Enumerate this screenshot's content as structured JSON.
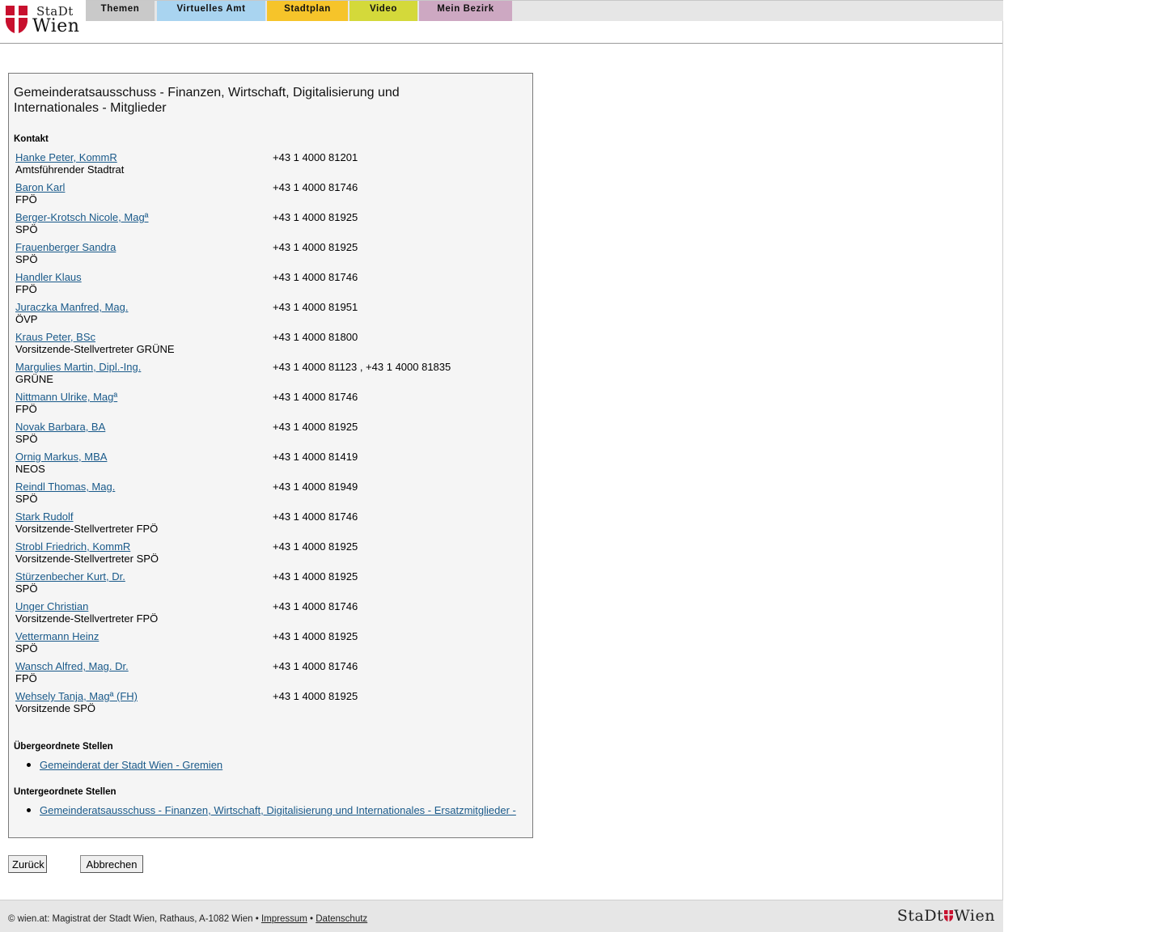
{
  "header": {
    "logo": {
      "line1": "StaDt",
      "line2": "Wien"
    },
    "nav": [
      "Themen",
      "Virtuelles Amt",
      "Stadtplan",
      "Video",
      "Mein Bezirk"
    ]
  },
  "panel": {
    "title": "Gemeinderatsausschuss - Finanzen, Wirtschaft, Digitalisierung und Internationales - Mitglieder",
    "contact_label": "Kontakt",
    "members": [
      {
        "name": "Hanke Peter, KommR",
        "role": "Amtsführender Stadtrat",
        "phone": "+43 1 4000 81201"
      },
      {
        "name": "Baron Karl",
        "role": "FPÖ",
        "phone": "+43 1 4000 81746"
      },
      {
        "name": "Berger-Krotsch Nicole, Magª",
        "role": "SPÖ",
        "phone": "+43 1 4000 81925"
      },
      {
        "name": "Frauenberger Sandra",
        "role": "SPÖ",
        "phone": "+43 1 4000 81925"
      },
      {
        "name": "Handler Klaus",
        "role": "FPÖ",
        "phone": "+43 1 4000 81746"
      },
      {
        "name": "Juraczka Manfred, Mag.",
        "role": "ÖVP",
        "phone": "+43 1 4000 81951"
      },
      {
        "name": "Kraus Peter, BSc",
        "role": "Vorsitzende-Stellvertreter GRÜNE",
        "phone": "+43 1 4000 81800"
      },
      {
        "name": "Margulies Martin, Dipl.-Ing.",
        "role": "GRÜNE",
        "phone": "+43 1 4000 81123 , +43 1 4000 81835"
      },
      {
        "name": "Nittmann Ulrike, Magª",
        "role": "FPÖ",
        "phone": "+43 1 4000 81746"
      },
      {
        "name": "Novak Barbara, BA",
        "role": "SPÖ",
        "phone": "+43 1 4000 81925"
      },
      {
        "name": "Ornig Markus, MBA",
        "role": "NEOS",
        "phone": "+43 1 4000 81419"
      },
      {
        "name": "Reindl Thomas, Mag.",
        "role": "SPÖ",
        "phone": "+43 1 4000 81949"
      },
      {
        "name": "Stark Rudolf",
        "role": "Vorsitzende-Stellvertreter FPÖ",
        "phone": "+43 1 4000 81746"
      },
      {
        "name": "Strobl Friedrich, KommR",
        "role": "Vorsitzende-Stellvertreter SPÖ",
        "phone": "+43 1 4000 81925"
      },
      {
        "name": "Stürzenbecher Kurt, Dr.",
        "role": "SPÖ",
        "phone": "+43 1 4000 81925"
      },
      {
        "name": "Unger Christian",
        "role": "Vorsitzende-Stellvertreter FPÖ",
        "phone": "+43 1 4000 81746"
      },
      {
        "name": "Vettermann Heinz",
        "role": "SPÖ",
        "phone": "+43 1 4000 81925"
      },
      {
        "name": "Wansch Alfred, Mag. Dr.",
        "role": "FPÖ",
        "phone": "+43 1 4000 81746"
      },
      {
        "name": "Wehsely Tanja, Magª (FH)",
        "role": "Vorsitzende SPÖ",
        "phone": "+43 1 4000 81925"
      }
    ],
    "parent_label": "Übergeordnete Stellen",
    "parent_links": [
      "Gemeinderat der Stadt Wien - Gremien"
    ],
    "child_label": "Untergeordnete Stellen",
    "child_links": [
      "Gemeinderatsausschuss - Finanzen, Wirtschaft, Digitalisierung und Internationales - Ersatzmitglieder -"
    ]
  },
  "buttons": {
    "back": "Zurück",
    "cancel": "Abbrechen"
  },
  "footer": {
    "copyright": "© wien.at: Magistrat der Stadt Wien, Rathaus, A-1082 Wien •",
    "impressum": "Impressum",
    "separator": "•",
    "datenschutz": "Datenschutz",
    "logo_left": "StaDt",
    "logo_right": "Wien"
  },
  "colors": {
    "link": "#1a5a8a",
    "shield_red": "#c8102e"
  },
  "icons": {
    "logo": "wien-shield-icon"
  }
}
